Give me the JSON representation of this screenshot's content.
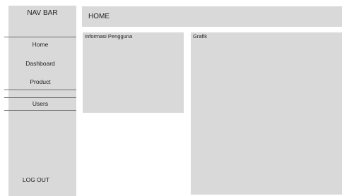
{
  "navbar": {
    "title": "NAV BAR",
    "items": [
      {
        "label": "Home"
      },
      {
        "label": "Dashboard"
      },
      {
        "label": "Product"
      },
      {
        "label": "Users"
      }
    ],
    "logout_label": "LOG OUT"
  },
  "header": {
    "title": "HOME"
  },
  "panels": {
    "user_info": {
      "title": "Informasi Pengguna"
    },
    "graph": {
      "title": "Grafik"
    }
  },
  "colors": {
    "panel_bg": "#d9d9d9",
    "page_bg": "#ffffff",
    "text": "#222222",
    "divider": "#6f6f6f"
  }
}
